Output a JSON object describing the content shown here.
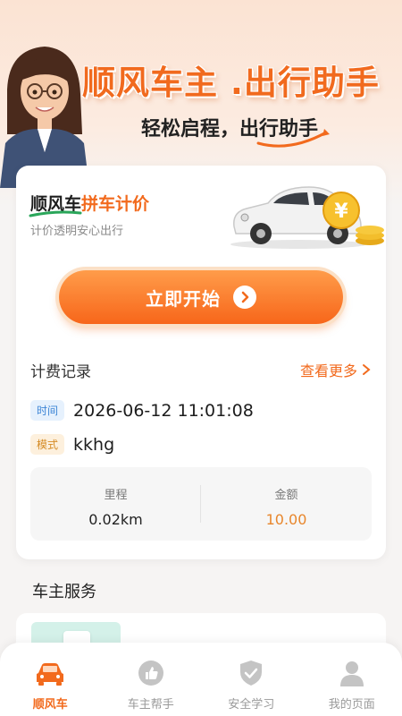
{
  "hero": {
    "title": "顺风车主 .出行助手",
    "subtitle": "轻松启程，出行助手"
  },
  "card": {
    "title_main": "顺风车",
    "title_accent": "拼车计价",
    "subtitle": "计价透明安心出行",
    "start_button": "立即开始",
    "record_title": "计费记录",
    "more_link": "查看更多",
    "time_tag": "时间",
    "time_value": "2026-06-12 11:01:08",
    "mode_tag": "模式",
    "mode_value": "kkhg",
    "distance_label": "里程",
    "distance_value": "0.02km",
    "amount_label": "金额",
    "amount_value": "10.00"
  },
  "services": {
    "title": "车主服务"
  },
  "tabs": [
    {
      "label": "顺风车",
      "icon": "car-icon",
      "active": true
    },
    {
      "label": "车主帮手",
      "icon": "thumbs-up-icon",
      "active": false
    },
    {
      "label": "安全学习",
      "icon": "shield-check-icon",
      "active": false
    },
    {
      "label": "我的页面",
      "icon": "user-icon",
      "active": false
    }
  ],
  "colors": {
    "accent": "#f26a1d",
    "time_tag_bg": "#e6f1fd",
    "mode_tag_bg": "#fdf0dd",
    "amount": "#e8862c"
  }
}
